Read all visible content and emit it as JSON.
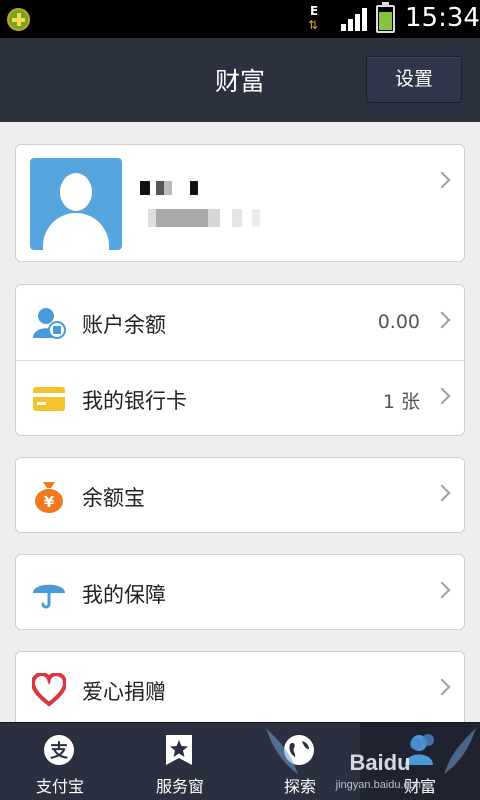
{
  "status_bar": {
    "time": "15:34",
    "network": "E",
    "battery_level": 0.75
  },
  "header": {
    "title": "财富",
    "settings_label": "设置"
  },
  "profile": {},
  "account": {
    "items": [
      {
        "label": "账户余额",
        "value": "0.00",
        "icon": "balance-icon"
      },
      {
        "label": "我的银行卡",
        "value": "1 张",
        "icon": "bank-card-icon"
      }
    ]
  },
  "yue_bao": {
    "label": "余额宝",
    "icon": "money-bag-icon"
  },
  "insurance": {
    "label": "我的保障",
    "icon": "umbrella-icon"
  },
  "charity": {
    "label": "爱心捐赠",
    "icon": "heart-icon"
  },
  "tabs": [
    {
      "label": "支付宝",
      "icon": "alipay-icon"
    },
    {
      "label": "服务窗",
      "icon": "star-icon"
    },
    {
      "label": "探索",
      "icon": "globe-icon"
    },
    {
      "label": "财富",
      "icon": "wealth-icon"
    }
  ],
  "watermark": {
    "text": "Baidu",
    "subtext": "jingyan.baidu.com"
  },
  "colors": {
    "header_bg": "#2c3140",
    "avatar_bg": "#56a5df",
    "card_yellow": "#f4c22b",
    "bag_orange": "#f07a1d",
    "umbrella_blue": "#4b9ad8",
    "heart_red": "#d9373f"
  }
}
